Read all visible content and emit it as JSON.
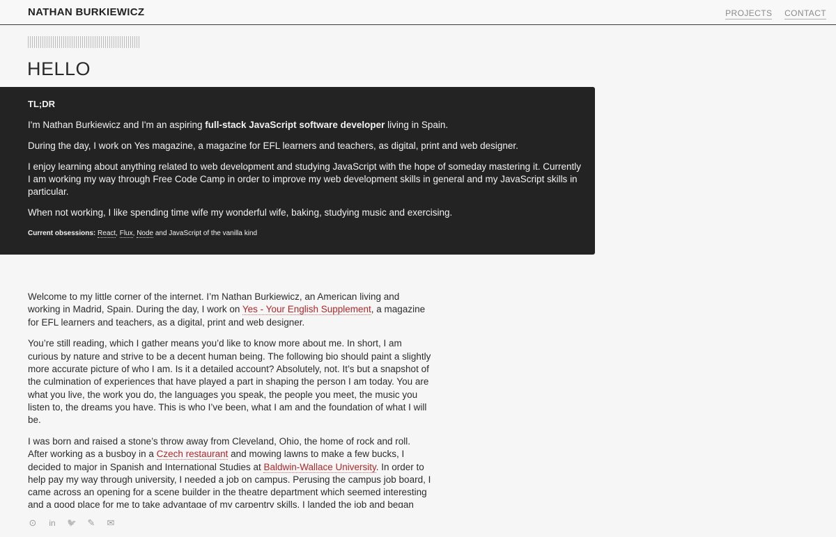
{
  "header": {
    "brand": "NATHAN BURKIEWICZ",
    "nav": [
      "PROJECTS",
      "CONTACT"
    ]
  },
  "hero": {
    "title": "HELLO"
  },
  "tldr": {
    "heading": "TL;DR",
    "p1_pre": "I'm Nathan Burkiewicz and I'm an aspiring ",
    "p1_bold": "full-stack JavaScript software developer",
    "p1_post": " living in Spain.",
    "p2": "During the day, I work on Yes magazine, a magazine for EFL learners and teachers, as digital, print and web designer.",
    "p3": "I enjoy learning about anything related to web development and studying JavaScript with the hope of someday mastering it. Currently I am working my way through Free Code Camp in order to improve my web development skills in general and my JavaScript skills in particular.",
    "p4": "When not working, I like spending time wife my wonderful wife, baking, studying music and exercising.",
    "obs_label": "Current obsessions:",
    "obs_links": [
      "React",
      "Flux",
      "Node"
    ],
    "obs_sep1": ", ",
    "obs_sep2": ", ",
    "obs_tail": " and JavaScript of the vanilla kind"
  },
  "content": {
    "p1_pre": "Welcome to my little corner of the internet. I’m Nathan Burkiewicz, an American living and working in Madrid, Spain. During the day, I work on ",
    "p1_link": "Yes - Your English Supplement",
    "p1_post": ", a magazine for EFL learners and teachers, as a digital, print and web designer.",
    "p2": "You’re still reading, which I gather means you’d like to know more about me. In short, I am curious by nature and strive to be a decent human being. The following bio should paint a slightly more accurate picture of who I am. Is it a detailed account? Absolutely, not. It’s but a snapshot of the culmination of experiences that have played a part in shaping the person I am today. You are what you live, the work you do, the languages you speak, the people you meet, the music you listen to, the dreams you have. This is who I’ve been, what I am and the foundation of what I will be.",
    "p3_a": "I was born and raised a stone’s throw away from Cleveland, Ohio, the home of rock and roll. After working as a busboy in a ",
    "p3_link1": "Czech restaurant",
    "p3_b": " and mowing lawns to make a few bucks, I decided to major in Spanish and International Studies at ",
    "p3_link2": "Baldwin-Wallace University",
    "p3_c": ". In order to help pay my way through university, I needed a job on campus. Perusing the campus job board, I came across an opening for a scene builder in the theatre department which seemed interesting and a good place for me to take advantage of my carpentry skills. I landed the job and began"
  },
  "social": {
    "icons": [
      "github-icon",
      "linkedin-icon",
      "twitter-icon",
      "pen-icon",
      "mail-icon"
    ],
    "glyphs": [
      "⊙",
      "in",
      "🐦",
      "✎",
      "✉"
    ]
  },
  "colors": {
    "accent_link": "#b0272a",
    "tldr_bg": "#232323",
    "page_bg": "#f6f6f6"
  }
}
